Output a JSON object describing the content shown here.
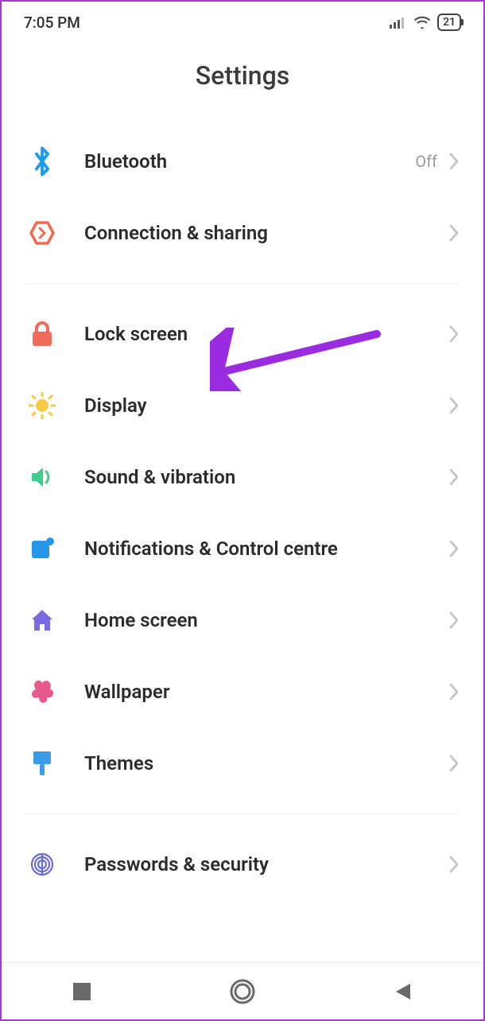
{
  "status": {
    "time": "7:05 PM",
    "battery": "21"
  },
  "title": "Settings",
  "groups": [
    {
      "items": [
        {
          "key": "bluetooth",
          "label": "Bluetooth",
          "value": "Off",
          "icon": "bluetooth",
          "color": "#1a9bf0"
        },
        {
          "key": "connection-sharing",
          "label": "Connection & sharing",
          "value": "",
          "icon": "share-hex",
          "color": "#f26a4b"
        }
      ]
    },
    {
      "items": [
        {
          "key": "lock-screen",
          "label": "Lock screen",
          "value": "",
          "icon": "lock",
          "color": "#f26a5a"
        },
        {
          "key": "display",
          "label": "Display",
          "value": "",
          "icon": "sun",
          "color": "#f9c846"
        },
        {
          "key": "sound-vibration",
          "label": "Sound & vibration",
          "value": "",
          "icon": "volume",
          "color": "#3dcf8b"
        },
        {
          "key": "notifications",
          "label": "Notifications & Control centre",
          "value": "",
          "icon": "badge-square",
          "color": "#2896e8"
        },
        {
          "key": "home-screen",
          "label": "Home screen",
          "value": "",
          "icon": "home",
          "color": "#7a6ce0"
        },
        {
          "key": "wallpaper",
          "label": "Wallpaper",
          "value": "",
          "icon": "flower",
          "color": "#e85a8c"
        },
        {
          "key": "themes",
          "label": "Themes",
          "value": "",
          "icon": "brush",
          "color": "#3a9be8"
        }
      ]
    },
    {
      "items": [
        {
          "key": "passwords-security",
          "label": "Passwords & security",
          "value": "",
          "icon": "fingerprint",
          "color": "#6a6ae0"
        }
      ]
    }
  ],
  "annotation": {
    "target": "lock-screen",
    "color": "#9a2be0"
  }
}
